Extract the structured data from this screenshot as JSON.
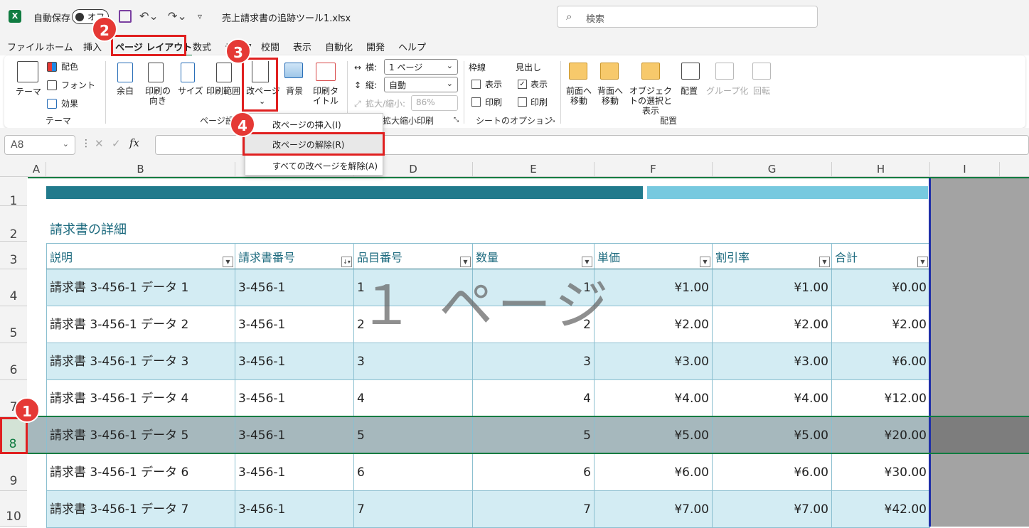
{
  "titlebar": {
    "autosave_label": "自動保存",
    "autosave_state": "オフ",
    "filename": "売上請求書の追跡ツール1.xlsx",
    "search_placeholder": "検索"
  },
  "tabs": [
    "ファイル",
    "ホーム",
    "挿入",
    "ページ レイアウト",
    "数式",
    "データ",
    "校閲",
    "表示",
    "自動化",
    "開発",
    "ヘルプ"
  ],
  "ribbon": {
    "theme_group": {
      "label": "テーマ",
      "theme": "テーマ",
      "colors": "配色",
      "fonts": "フォント",
      "effects": "効果"
    },
    "page_setup_group": {
      "label": "ページ設定",
      "margins": "余白",
      "orientation": "印刷の向き",
      "size": "サイズ",
      "print_area": "印刷範囲",
      "breaks": "改ページ",
      "background": "背景",
      "print_titles": "印刷タイトル"
    },
    "scale_group": {
      "label": "拡大縮小印刷",
      "width_label": "横:",
      "width_value": "1 ページ",
      "height_label": "縦:",
      "height_value": "自動",
      "scale_label": "拡大/縮小:",
      "scale_value": "86%"
    },
    "sheet_options_group": {
      "label": "シートのオプション",
      "gridlines": "枠線",
      "headings": "見出し",
      "view": "表示",
      "print": "印刷"
    },
    "arrange_group": {
      "label": "配置",
      "bring_forward": "前面へ移動",
      "send_backward": "背面へ移動",
      "selection_pane": "オブジェクトの選択と表示",
      "align": "配置",
      "group": "グループ化",
      "rotate": "回転"
    }
  },
  "menu": {
    "insert": "改ページの挿入(I)",
    "remove": "改ページの解除(R)",
    "reset": "すべての改ページを解除(A)"
  },
  "formula_bar": {
    "name_box": "A8",
    "fx": "fx"
  },
  "columns": [
    "A",
    "B",
    "C",
    "D",
    "E",
    "F",
    "G",
    "H",
    "I"
  ],
  "rows": [
    "1",
    "2",
    "3",
    "4",
    "5",
    "6",
    "7",
    "8",
    "9",
    "10"
  ],
  "sheet": {
    "title": "請求書の詳細",
    "watermark": "１ ページ",
    "headers": [
      "説明",
      "請求書番号",
      "品目番号",
      "数量",
      "単価",
      "割引率",
      "合計"
    ],
    "data": [
      [
        "請求書 3-456-1 データ 1",
        "3-456-1",
        "1",
        "1",
        "¥1.00",
        "¥1.00",
        "¥0.00"
      ],
      [
        "請求書 3-456-1 データ 2",
        "3-456-1",
        "2",
        "2",
        "¥2.00",
        "¥2.00",
        "¥2.00"
      ],
      [
        "請求書 3-456-1 データ 3",
        "3-456-1",
        "3",
        "3",
        "¥3.00",
        "¥3.00",
        "¥6.00"
      ],
      [
        "請求書 3-456-1 データ 4",
        "3-456-1",
        "4",
        "4",
        "¥4.00",
        "¥4.00",
        "¥12.00"
      ],
      [
        "請求書 3-456-1 データ 5",
        "3-456-1",
        "5",
        "5",
        "¥5.00",
        "¥5.00",
        "¥20.00"
      ],
      [
        "請求書 3-456-1 データ 6",
        "3-456-1",
        "6",
        "6",
        "¥6.00",
        "¥6.00",
        "¥30.00"
      ],
      [
        "請求書 3-456-1 データ 7",
        "3-456-1",
        "7",
        "7",
        "¥7.00",
        "¥7.00",
        "¥42.00"
      ]
    ]
  },
  "callouts": [
    "1",
    "2",
    "3",
    "4"
  ],
  "colors": {
    "accent": "#107c41",
    "table_header": "#1e6b7f",
    "band_dark": "#217a8c",
    "band_light": "#77c9df",
    "row_alt": "#d3ecf3",
    "row_selected": "#a6b8bd",
    "callout": "#e53935"
  }
}
